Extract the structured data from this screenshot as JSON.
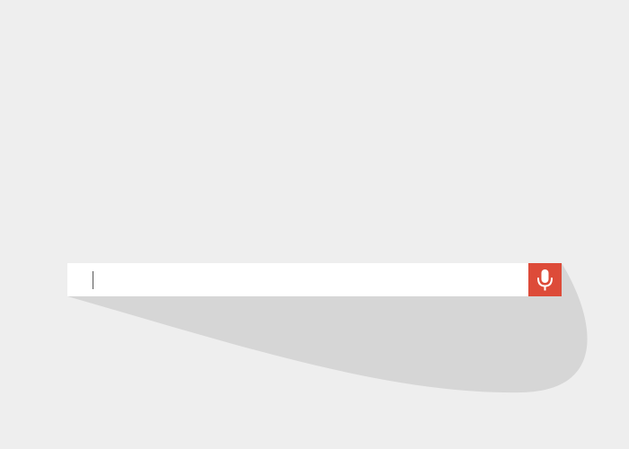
{
  "search": {
    "value": "",
    "placeholder": ""
  },
  "mic_button": {
    "icon": "microphone-icon",
    "color": "#dd4b39"
  },
  "colors": {
    "background": "#eeeeee",
    "bar": "#ffffff",
    "shadow": "#d6d6d6"
  }
}
